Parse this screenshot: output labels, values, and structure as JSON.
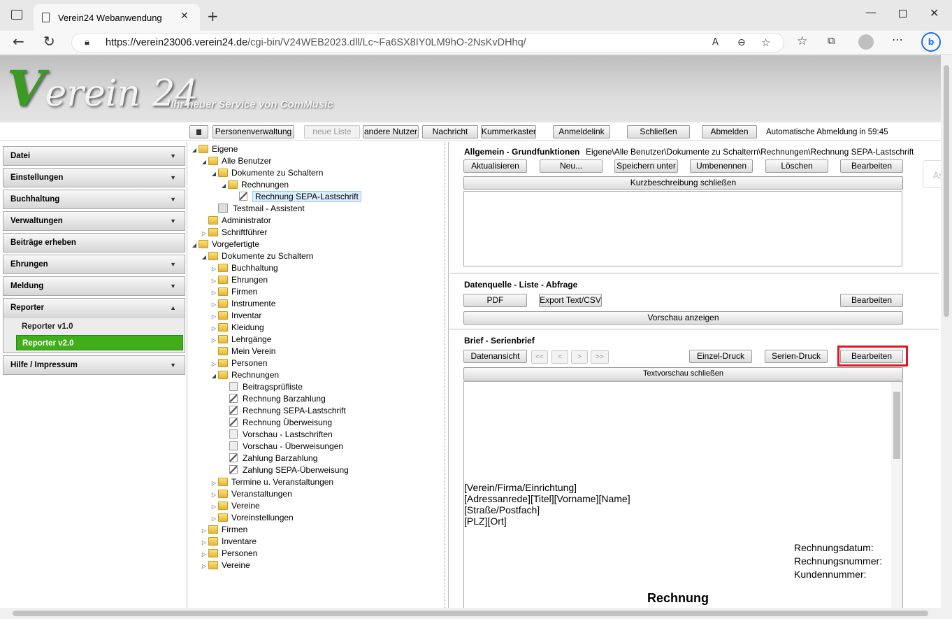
{
  "browser": {
    "tab_title": "Verein24 Webanwendung",
    "url_host": "https://verein23006.verein24.de",
    "url_path": "/cgi-bin/V24WEB2023.dll/Lc~Fa6SX8IY0LM9hO-2NsKvDHhq/"
  },
  "banner": {
    "logo_v": "V",
    "logo_rest": "erein 24",
    "slogan": "Ihr neuer Service von ComMusic"
  },
  "toolbar": {
    "personenverwaltung": "Personenverwaltung",
    "neue_liste": "neue Liste",
    "andere_nutzer": "andere Nutzer",
    "nachricht": "Nachricht",
    "kummerkasten": "Kummerkasten",
    "anmeldelink": "Anmeldelink",
    "schliessen": "Schließen",
    "abmelden": "Abmelden",
    "auto_logout": "Automatische Abmeldung in 59:45"
  },
  "menu": {
    "items": [
      {
        "label": "Datei"
      },
      {
        "label": "Einstellungen"
      },
      {
        "label": "Buchhaltung"
      },
      {
        "label": "Verwaltungen"
      },
      {
        "label": "Beiträge erheben"
      },
      {
        "label": "Ehrungen"
      },
      {
        "label": "Meldung"
      },
      {
        "label": "Reporter"
      },
      {
        "label": "Hilfe / Impressum"
      }
    ],
    "reporter_sub": [
      "Reporter v1.0",
      "Reporter v2.0"
    ]
  },
  "tree": [
    "Eigene",
    "Alle Benutzer",
    "Dokumente zu Schaltern",
    "Rechnungen",
    "Rechnung SEPA-Lastschrift",
    "Testmail - Assistent",
    "Administrator",
    "Schriftführer",
    "Vorgefertigte",
    "Dokumente zu Schaltern",
    "Buchhaltung",
    "Ehrungen",
    "Firmen",
    "Instrumente",
    "Inventar",
    "Kleidung",
    "Lehrgänge",
    "Mein Verein",
    "Personen",
    "Rechnungen",
    "Beitragsprüfliste",
    "Rechnung Barzahlung",
    "Rechnung SEPA-Lastschrift",
    "Rechnung Überweisung",
    "Vorschau - Lastschriften",
    "Vorschau - Überweisungen",
    "Zahlung Barzahlung",
    "Zahlung SEPA-Überweisung",
    "Termine u. Veranstaltungen",
    "Veranstaltungen",
    "Vereine",
    "Voreinstellungen",
    "Firmen",
    "Inventare",
    "Personen",
    "Vereine"
  ],
  "allgemein": {
    "title": "Allgemein - Grundfunktionen",
    "path": "Eigene\\Alle Benutzer\\Dokumente zu Schaltern\\Rechnungen\\Rechnung SEPA-Lastschrift",
    "aktualisieren": "Aktualisieren",
    "neu": "Neu...",
    "speichern_unter": "Speichern unter",
    "umbenennen": "Umbenennen",
    "loeschen": "Löschen",
    "bearbeiten": "Bearbeiten",
    "kurzbeschreibung": "Kurzbeschreibung schließen",
    "cut_label": "As"
  },
  "datenquelle": {
    "title": "Datenquelle - Liste - Abfrage",
    "pdf": "PDF",
    "export": "Export Text/CSV",
    "bearbeiten": "Bearbeiten",
    "vorschau": "Vorschau anzeigen"
  },
  "brief": {
    "title": "Brief - Serienbrief",
    "datenansicht": "Datenansicht",
    "first": "<<",
    "prev": "<",
    "next": ">",
    "last": ">>",
    "einzel": "Einzel-Druck",
    "serien": "Serien-Druck",
    "bearbeiten": "Bearbeiten",
    "textvorschau": "Textvorschau schließen"
  },
  "letter": {
    "address": [
      "[Verein/Firma/Einrichtung]",
      "[Adressanrede][Titel][Vorname][Name]",
      "[Straße/Postfach]",
      "[PLZ][Ort]"
    ],
    "meta": [
      "Rechnungsdatum:",
      "Rechnungsnummer:",
      "Kundennummer:"
    ],
    "heading": "Rechnung"
  },
  "colors": {
    "accent_green": "#3fae1a",
    "highlight_red": "#e2141c"
  }
}
